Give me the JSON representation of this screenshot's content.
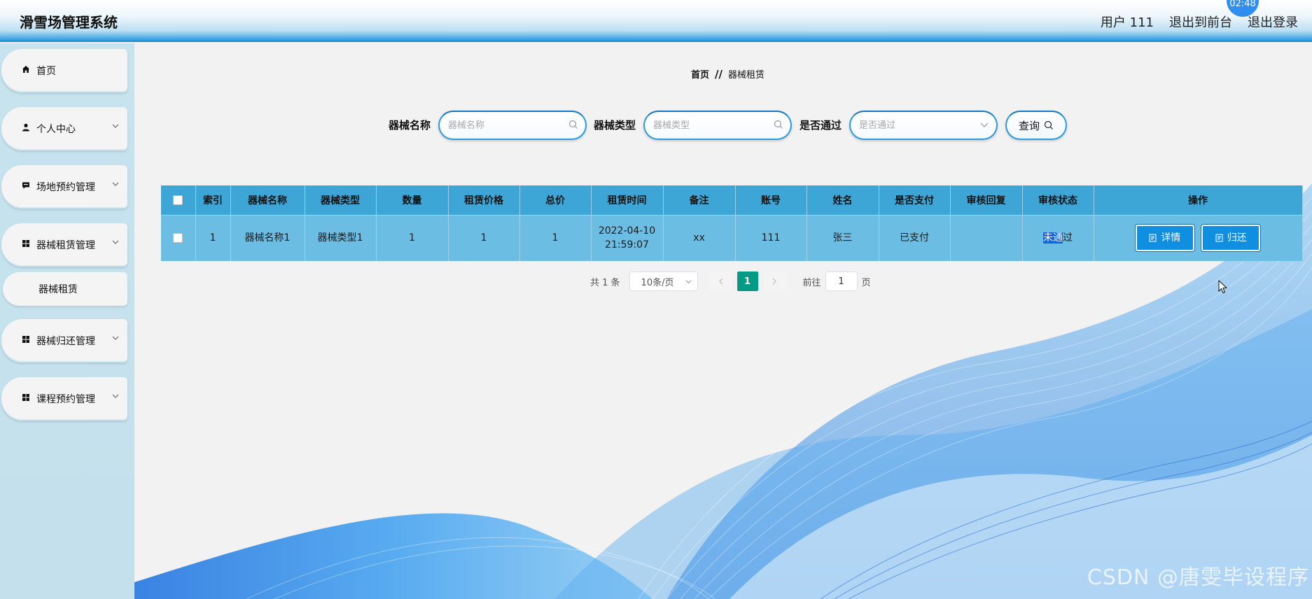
{
  "header": {
    "title": "滑雪场管理系统",
    "clock": "02:48",
    "user": "用户 111",
    "to_front": "退出到前台",
    "logout": "退出登录"
  },
  "sidebar": {
    "items": [
      {
        "label": "首页",
        "icon": "home-icon"
      },
      {
        "label": "个人中心",
        "icon": "user-icon"
      },
      {
        "label": "场地预约管理",
        "icon": "message-icon"
      },
      {
        "label": "器械租赁管理",
        "icon": "grid-icon"
      },
      {
        "label": "器械归还管理",
        "icon": "grid-icon"
      },
      {
        "label": "课程预约管理",
        "icon": "grid-icon"
      }
    ],
    "sub_item": "器械租赁"
  },
  "breadcrumb": {
    "home": "首页",
    "sep": "//",
    "current": "器械租赁"
  },
  "search": {
    "name_label": "器械名称",
    "name_placeholder": "器械名称",
    "type_label": "器械类型",
    "type_placeholder": "器械类型",
    "pass_label": "是否通过",
    "pass_placeholder": "是否通过",
    "query_label": "查询"
  },
  "table": {
    "headers": [
      "索引",
      "器械名称",
      "器械类型",
      "数量",
      "租赁价格",
      "总价",
      "租赁时间",
      "备注",
      "账号",
      "姓名",
      "是否支付",
      "审核回复",
      "审核状态",
      "操作"
    ],
    "rows": [
      {
        "index": "1",
        "name": "器械名称1",
        "type": "器械类型1",
        "qty": "1",
        "price": "1",
        "total": "1",
        "date": "2022-04-10",
        "time": "21:59:07",
        "remark": "xx",
        "account": "111",
        "person": "张三",
        "paid": "已支付",
        "reply": "",
        "status_hl": "未通",
        "status_rest": "过"
      }
    ],
    "detail_label": "详情",
    "return_label": "归还"
  },
  "pager": {
    "total": "共 1 条",
    "page_size": "10条/页",
    "current": "1",
    "goto_label": "前往",
    "goto_value": "1",
    "page_unit": "页"
  },
  "watermark": "CSDN @唐雯毕设程序"
}
